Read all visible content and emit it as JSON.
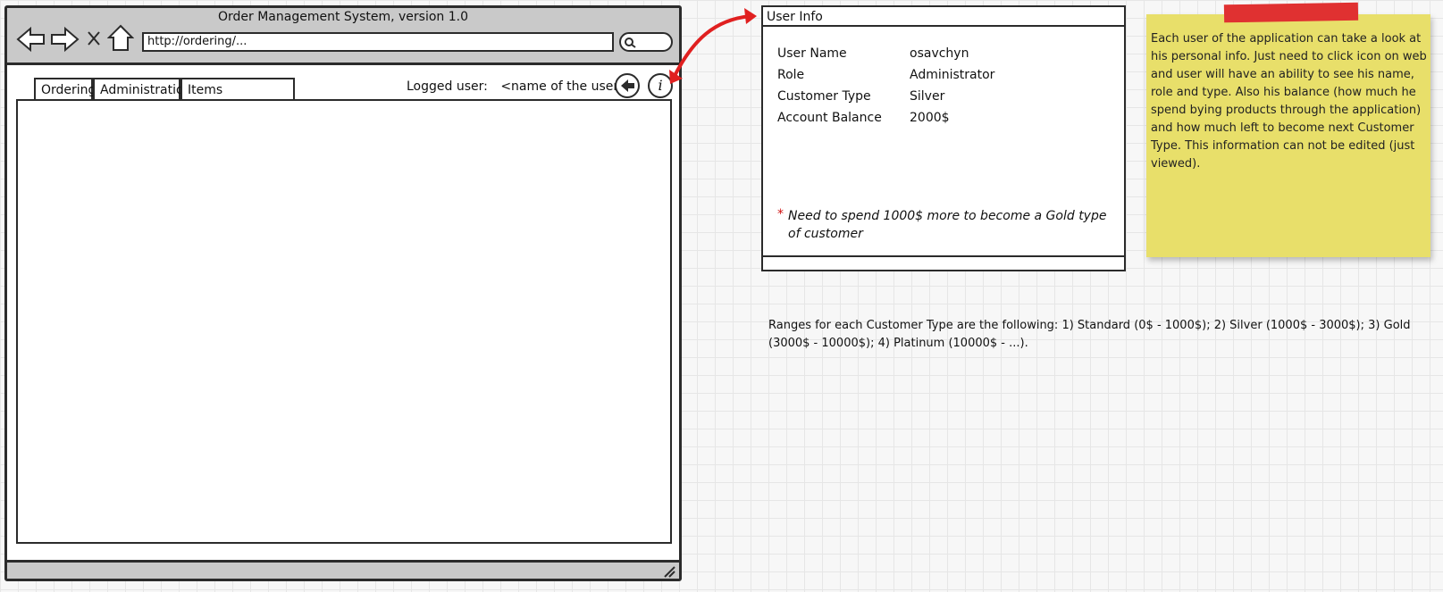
{
  "window": {
    "title": "Order Management System, version 1.0",
    "url": "http://ordering/..."
  },
  "tabs": [
    {
      "label": "Ordering"
    },
    {
      "label": "Administration"
    },
    {
      "label": "Items Management"
    }
  ],
  "logged_user": {
    "label": "Logged user:",
    "value": "<name of the user>"
  },
  "panel": {
    "title": "User Info",
    "rows": [
      {
        "label": "User Name",
        "value": "osavchyn"
      },
      {
        "label": "Role",
        "value": "Administrator"
      },
      {
        "label": "Customer Type",
        "value": "Silver"
      },
      {
        "label": "Account Balance",
        "value": "2000$"
      }
    ],
    "note_marker": "*",
    "note": "Need to spend 1000$ more to become a Gold type of customer"
  },
  "sticky_note": {
    "text": "Each user of the application can take a look at his personal info. Just need to click icon on web and user will have an ability to see his name, role and type. Also his balance (how much he spend bying products through the application) and how much left to become next Customer Type. This information can not be edited (just viewed)."
  },
  "ranges_note": "Ranges for each Customer Type are the following: 1) Standard (0$ - 1000$); 2) Silver (1000$ - 3000$); 3) Gold (3000$ - 10000$); 4) Platinum (10000$ - ...).",
  "colors": {
    "arrow": "#e02020",
    "sticky": "#e8df6a",
    "tape": "#e03131",
    "note_marker": "#d01010"
  },
  "icons": [
    "back-arrow-icon",
    "forward-arrow-icon",
    "close-icon",
    "home-icon",
    "search-icon",
    "logout-icon",
    "info-icon",
    "resize-grip-icon"
  ]
}
